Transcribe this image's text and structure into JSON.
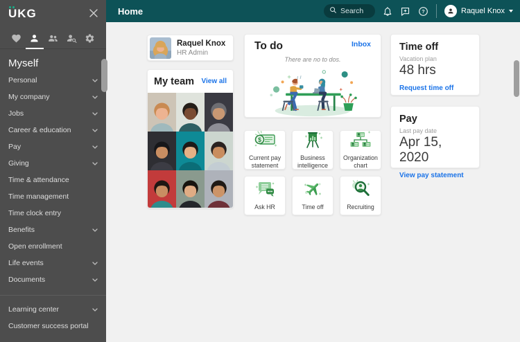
{
  "colors": {
    "topbar_teal": "#0d5257",
    "sidebar_gray": "#4d4d4d",
    "link_blue": "#1a73e8",
    "accent_green": "#2f8a43",
    "logo_dot_teal": "#18b08b"
  },
  "sidebar": {
    "logo_text": "UKG",
    "section_title": "Myself",
    "tabs": [
      {
        "icon": "heart-icon",
        "active": false
      },
      {
        "icon": "person-icon",
        "active": true
      },
      {
        "icon": "people-icon",
        "active": false
      },
      {
        "icon": "person-search-icon",
        "active": false
      },
      {
        "icon": "gear-icon",
        "active": false
      }
    ],
    "items": [
      {
        "label": "Personal",
        "chevron": true
      },
      {
        "label": "My company",
        "chevron": true
      },
      {
        "label": "Jobs",
        "chevron": true
      },
      {
        "label": "Career & education",
        "chevron": true
      },
      {
        "label": "Pay",
        "chevron": true
      },
      {
        "label": "Giving",
        "chevron": true
      },
      {
        "label": "Time & attendance",
        "chevron": false
      },
      {
        "label": "Time management",
        "chevron": false
      },
      {
        "label": "Time clock entry",
        "chevron": false
      },
      {
        "label": "Benefits",
        "chevron": true
      },
      {
        "label": "Open enrollment",
        "chevron": false
      },
      {
        "label": "Life events",
        "chevron": true
      },
      {
        "label": "Documents",
        "chevron": true
      }
    ],
    "footer_items": [
      {
        "label": "Learning center",
        "chevron": true
      },
      {
        "label": "Customer success portal",
        "chevron": false
      }
    ]
  },
  "topbar": {
    "title": "Home",
    "search_placeholder": "Search",
    "user_name": "Raquel Knox"
  },
  "profile_card": {
    "name": "Raquel Knox",
    "role": "HR Admin"
  },
  "todo_card": {
    "title": "To do",
    "link_label": "Inbox",
    "empty_message": "There are no to dos."
  },
  "team_card": {
    "title": "My team",
    "link_label": "View all",
    "members": [
      {
        "bg": "#cdc4b6",
        "skin": "#edb391",
        "hair": "#c98a52",
        "shirt": "#9fb9bd"
      },
      {
        "bg": "#dfe3dc",
        "skin": "#7a4b32",
        "hair": "#241d18",
        "shirt": "#2e5f63"
      },
      {
        "bg": "#3a3a42",
        "skin": "#c99873",
        "hair": "#6d6d72",
        "shirt": "#8e8e96"
      },
      {
        "bg": "#2e2e33",
        "skin": "#c98e62",
        "hair": "#17171a",
        "shirt": "#3c3c44"
      },
      {
        "bg": "#0e8a96",
        "skin": "#e5b186",
        "hair": "#1d1a18",
        "shirt": "#0b6d77"
      },
      {
        "bg": "#ccd6cf",
        "skin": "#c98d5f",
        "hair": "#2a2220",
        "shirt": "#c3cdd3"
      },
      {
        "bg": "#c23b3b",
        "skin": "#c98e62",
        "hair": "#1f1713",
        "shirt": "#2e8c8c"
      },
      {
        "bg": "#8a9a8e",
        "skin": "#e0ac84",
        "hair": "#17140f",
        "shirt": "#23252a"
      },
      {
        "bg": "#aeb2ba",
        "skin": "#cc9468",
        "hair": "#201a16",
        "shirt": "#6e3038"
      }
    ]
  },
  "tiles": [
    {
      "label": "Current pay statement",
      "icon": "pay-statement-icon"
    },
    {
      "label": "Business intelligence",
      "icon": "chart-easel-icon"
    },
    {
      "label": "Organization chart",
      "icon": "org-chart-icon"
    },
    {
      "label": "Ask HR",
      "icon": "chat-bubbles-icon"
    },
    {
      "label": "Time off",
      "icon": "airplane-icon"
    },
    {
      "label": "Recruiting",
      "icon": "search-person-icon"
    }
  ],
  "timeoff_card": {
    "title": "Time off",
    "plan_label": "Vacation plan",
    "value": "48 hrs",
    "link_label": "Request time off"
  },
  "pay_card": {
    "title": "Pay",
    "date_label": "Last pay date",
    "value": "Apr 15, 2020",
    "link_label": "View pay statement"
  }
}
